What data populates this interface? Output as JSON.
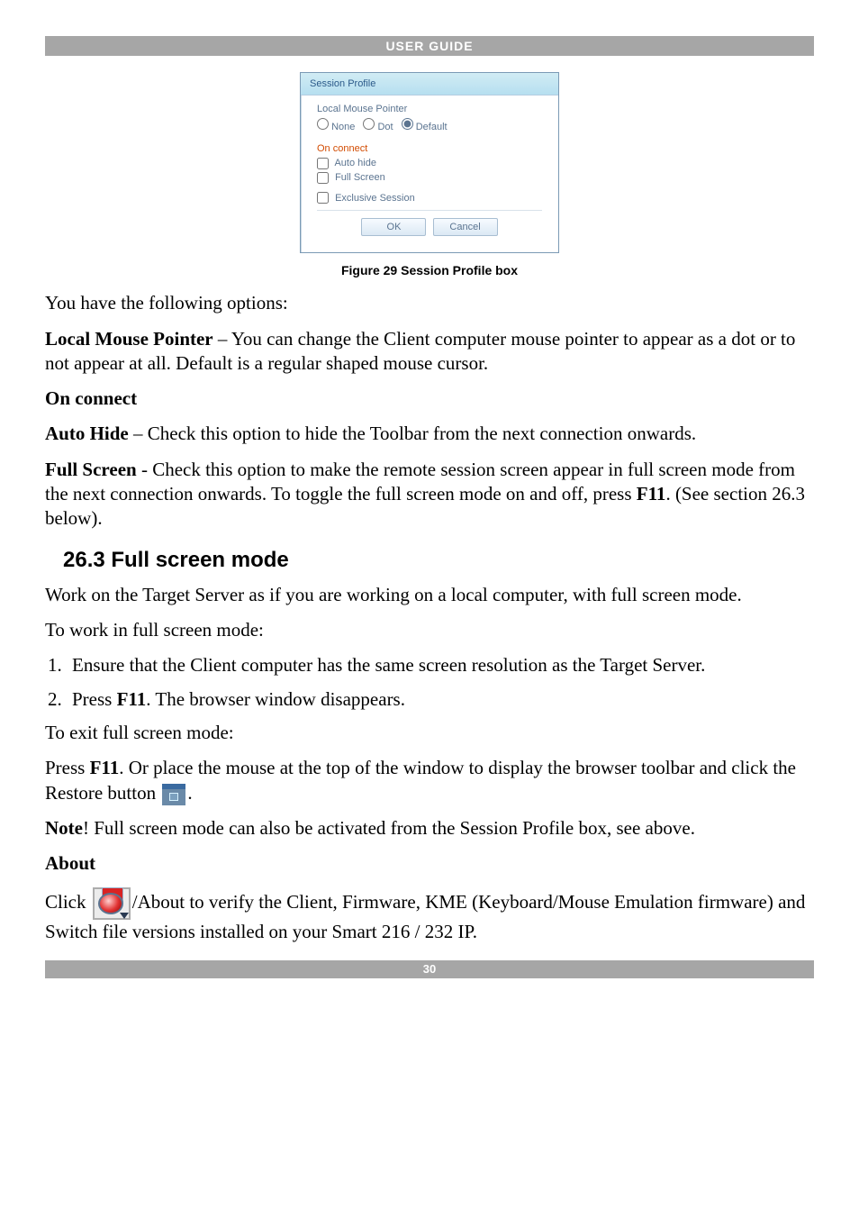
{
  "header": {
    "title": "USER GUIDE"
  },
  "dialog": {
    "title": "Session Profile",
    "local_mouse_label": "Local Mouse Pointer",
    "radio_none": "None",
    "radio_dot": "Dot",
    "radio_default": "Default",
    "radio_selected": "Default",
    "on_connect_label": "On connect",
    "auto_hide_label": "Auto hide",
    "auto_hide_checked": false,
    "full_screen_label": "Full Screen",
    "full_screen_checked": false,
    "exclusive_label": "Exclusive Session",
    "exclusive_checked": false,
    "ok_label": "OK",
    "cancel_label": "Cancel"
  },
  "caption": "Figure 29 Session Profile box",
  "body": {
    "intro": "You have the following options:",
    "lmp_bold": "Local Mouse Pointer",
    "lmp_text": " – You can change the Client computer mouse pointer to appear as a dot or to not appear at all. Default is a regular shaped mouse cursor.",
    "on_connect_bold": "On connect",
    "auto_bold": "Auto Hide",
    "auto_text": " – Check this option to hide the Toolbar from the next connection onwards.",
    "full_bold": "Full Screen",
    "full_text": " - Check this option to make the remote session screen appear in full screen mode from the next connection onwards. To toggle the full screen mode on and off, press ",
    "f11_1": "F11",
    "full_tail": ". (See section 26.3 below).",
    "section_title": "26.3 Full screen mode",
    "work_para": "Work on the Target Server as if you are working on a local computer, with full screen mode.",
    "to_work": "To work in full screen mode:",
    "step1": "Ensure that the Client computer has the same screen resolution as the Target Server.",
    "step2a": "Press ",
    "step2_f11": "F11",
    "step2b": ". The browser window disappears.",
    "to_exit": "To exit full screen mode:",
    "exit_a": "Press ",
    "exit_f11": "F11",
    "exit_b": ". Or place the mouse at the top of the window to display the browser toolbar and click the Restore button ",
    "exit_c": ".",
    "note_bold": "Note",
    "note_text": "! Full screen mode can also be activated from the Session Profile box, see above.",
    "about_bold": "About",
    "click_a": "Click ",
    "click_b": "/About to verify the Client, Firmware, KME (Keyboard/Mouse Emulation firmware) and Switch file versions installed on your Smart 216 / 232 IP."
  },
  "footer": {
    "page": "30"
  }
}
